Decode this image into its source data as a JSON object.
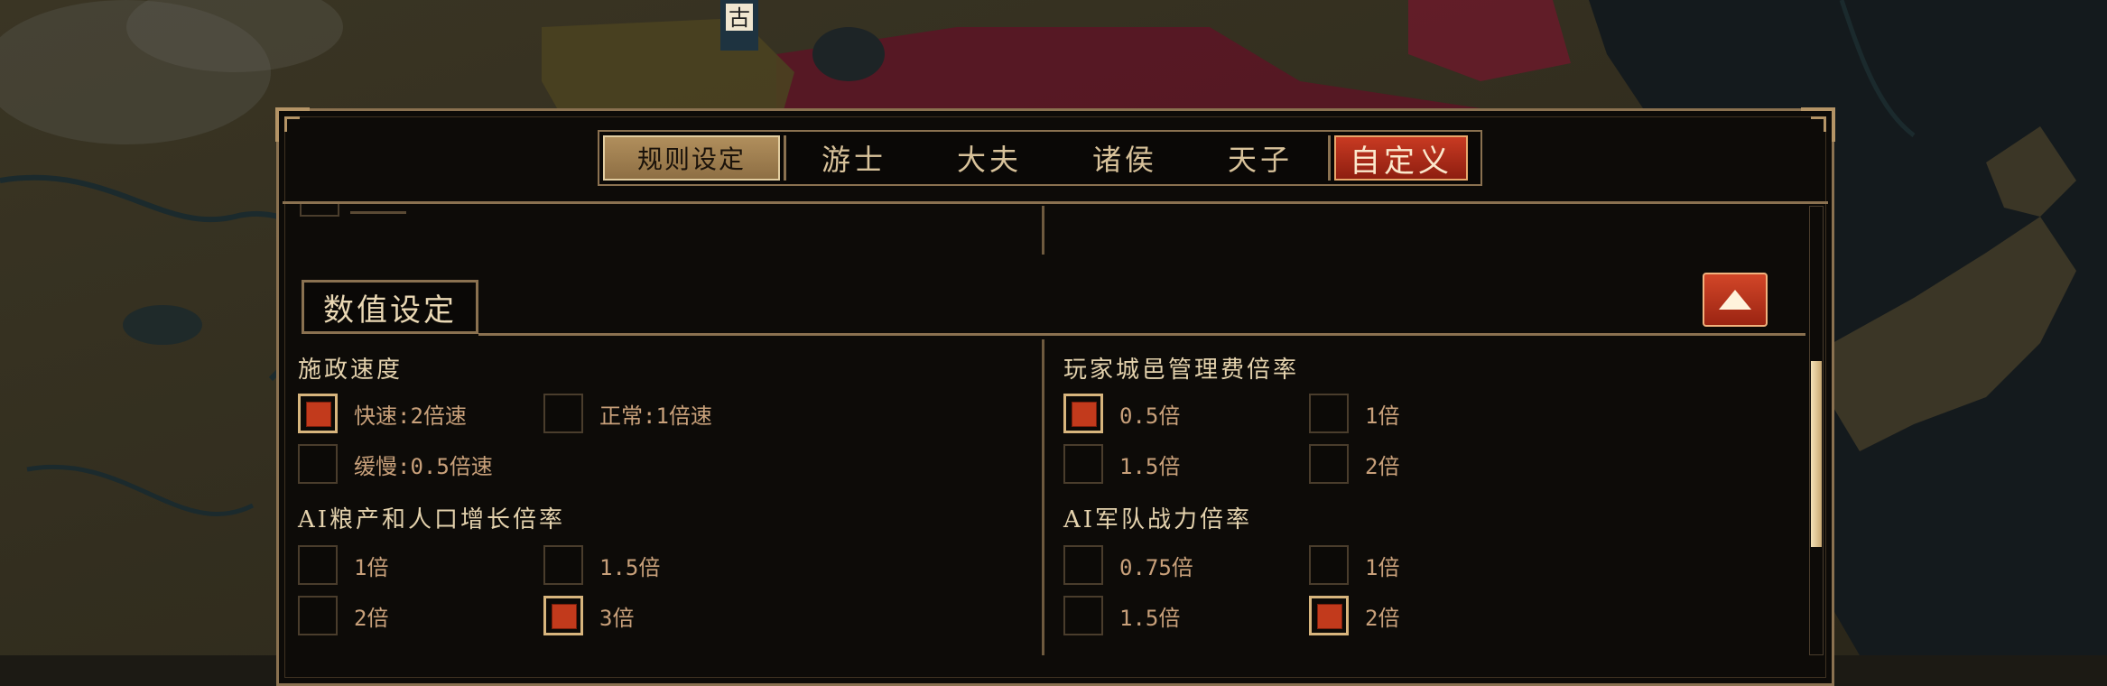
{
  "tabs": {
    "rules": "规则设定",
    "levels": [
      "游士",
      "大夫",
      "诸侯",
      "天子"
    ],
    "custom": "自定义"
  },
  "map_label": "古",
  "section": {
    "title": "数值设定"
  },
  "groups": [
    {
      "title": "施政速度",
      "options": [
        {
          "label": "快速:2倍速",
          "checked": true
        },
        {
          "label": "正常:1倍速",
          "checked": false
        },
        {
          "label": "缓慢:0.5倍速",
          "checked": false
        }
      ]
    },
    {
      "title": "玩家城邑管理费倍率",
      "options": [
        {
          "label": "0.5倍",
          "checked": true
        },
        {
          "label": "1倍",
          "checked": false
        },
        {
          "label": "1.5倍",
          "checked": false
        },
        {
          "label": "2倍",
          "checked": false
        }
      ]
    },
    {
      "title": "AI粮产和人口增长倍率",
      "options": [
        {
          "label": "1倍",
          "checked": false
        },
        {
          "label": "1.5倍",
          "checked": false
        },
        {
          "label": "2倍",
          "checked": false
        },
        {
          "label": "3倍",
          "checked": true
        }
      ]
    },
    {
      "title": "AI军队战力倍率",
      "options": [
        {
          "label": "0.75倍",
          "checked": false
        },
        {
          "label": "1倍",
          "checked": false
        },
        {
          "label": "1.5倍",
          "checked": false
        },
        {
          "label": "2倍",
          "checked": true
        }
      ]
    }
  ],
  "colors": {
    "accent_red": "#c23a1c",
    "frame_gold": "#8a7150",
    "text_gold": "#e4d2ad"
  }
}
